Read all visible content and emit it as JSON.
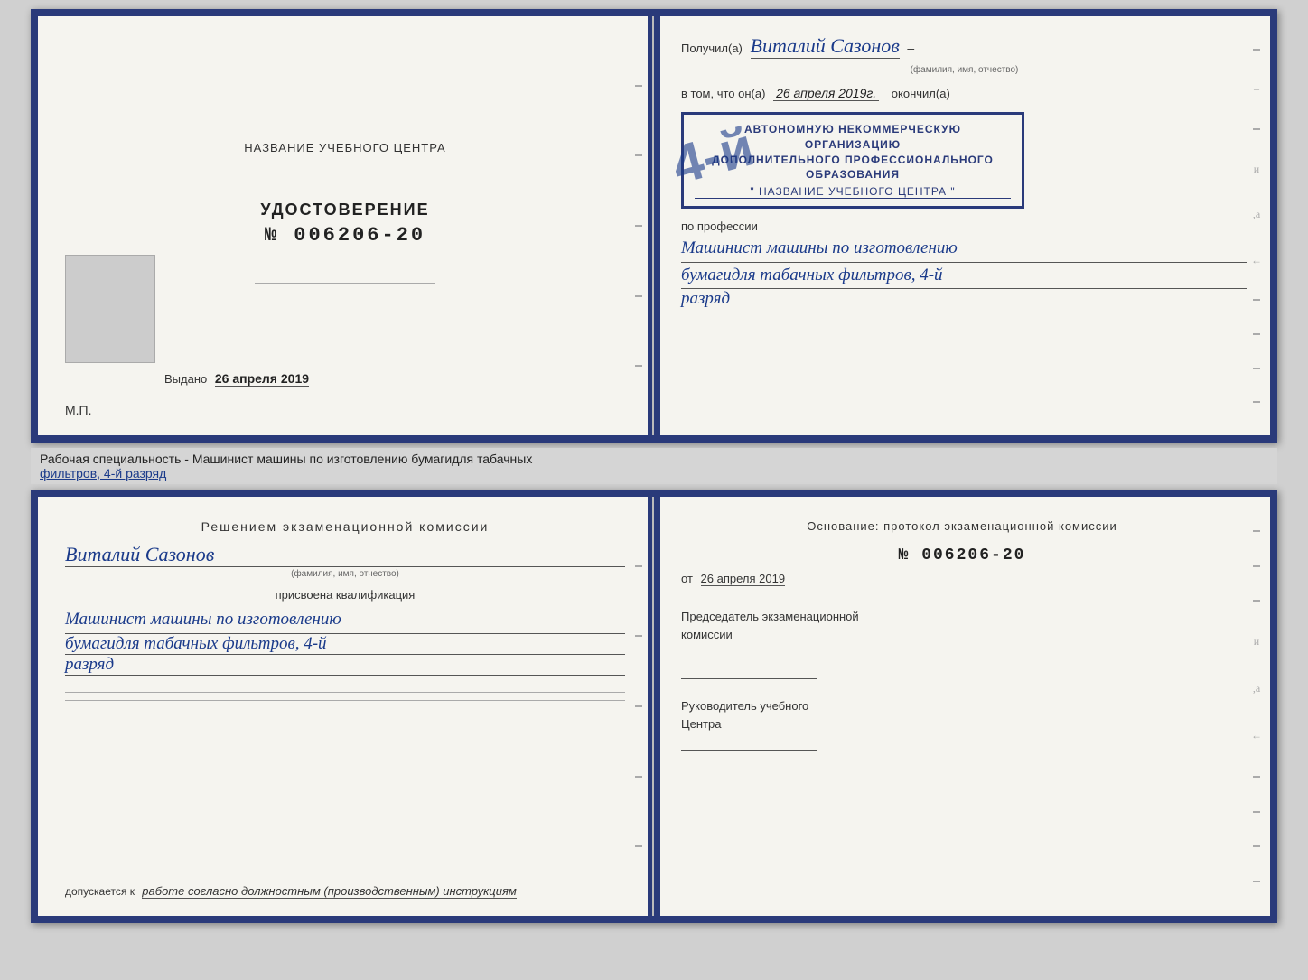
{
  "page": {
    "background_color": "#d0d0d0"
  },
  "top_document": {
    "left_page": {
      "org_name_label": "НАЗВАНИЕ УЧЕБНОГО ЦЕНТРА",
      "cert_title": "УДОСТОВЕРЕНИЕ",
      "cert_number_prefix": "№",
      "cert_number": "006206-20",
      "issued_label": "Выдано",
      "issued_date": "26 апреля 2019",
      "mp_label": "М.П."
    },
    "right_page": {
      "received_prefix": "Получил(а)",
      "received_name": "Виталий Сазонов",
      "name_hint": "(фамилия, имя, отчество)",
      "in_that_prefix": "в том, что он(а)",
      "in_that_date": "26 апреля 2019г.",
      "finished_word": "окончил(а)",
      "stamp_line1": "АВТОНОМНУЮ НЕКОММЕРЧЕСКУЮ ОРГАНИЗАЦИЮ",
      "stamp_line2": "ДОПОЛНИТЕЛЬНОГО ПРОФЕССИОНАЛЬНОГО ОБРАЗОВАНИЯ",
      "stamp_line3": "\" НАЗВАНИЕ УЧЕБНОГО ЦЕНТРА \"",
      "profession_label": "по профессии",
      "profession_line1": "Машинист машины по изготовлению",
      "profession_line2": "бумагидля табачных фильтров, 4-й",
      "profession_line3": "разряд"
    }
  },
  "middle_label": {
    "static_text": "Рабочая специальность - Машинист машины по изготовлению бумагидля табачных",
    "underline_text": "фильтров, 4-й разряд"
  },
  "bottom_document": {
    "left_page": {
      "commission_title": "Решением  экзаменационной  комиссии",
      "person_name": "Виталий Сазонов",
      "fio_hint": "(фамилия, имя, отчество)",
      "qualification_label": "присвоена квалификация",
      "qual_line1": "Машинист машины по изготовлению",
      "qual_line2": "бумагидля табачных фильтров, 4-й",
      "qual_line3": "разряд",
      "admitted_prefix": "допускается к",
      "admitted_value": "работе согласно должностным (производственным) инструкциям"
    },
    "right_page": {
      "basis_title": "Основание:  протокол  экзаменационной  комиссии",
      "protocol_prefix": "№",
      "protocol_number": "006206-20",
      "date_prefix": "от",
      "date_value": "26 апреля 2019",
      "chairman_label": "Председатель экзаменационной",
      "chairman_label2": "комиссии",
      "director_label1": "Руководитель учебного",
      "director_label2": "Центра"
    }
  },
  "icons": {
    "dash": "–"
  }
}
